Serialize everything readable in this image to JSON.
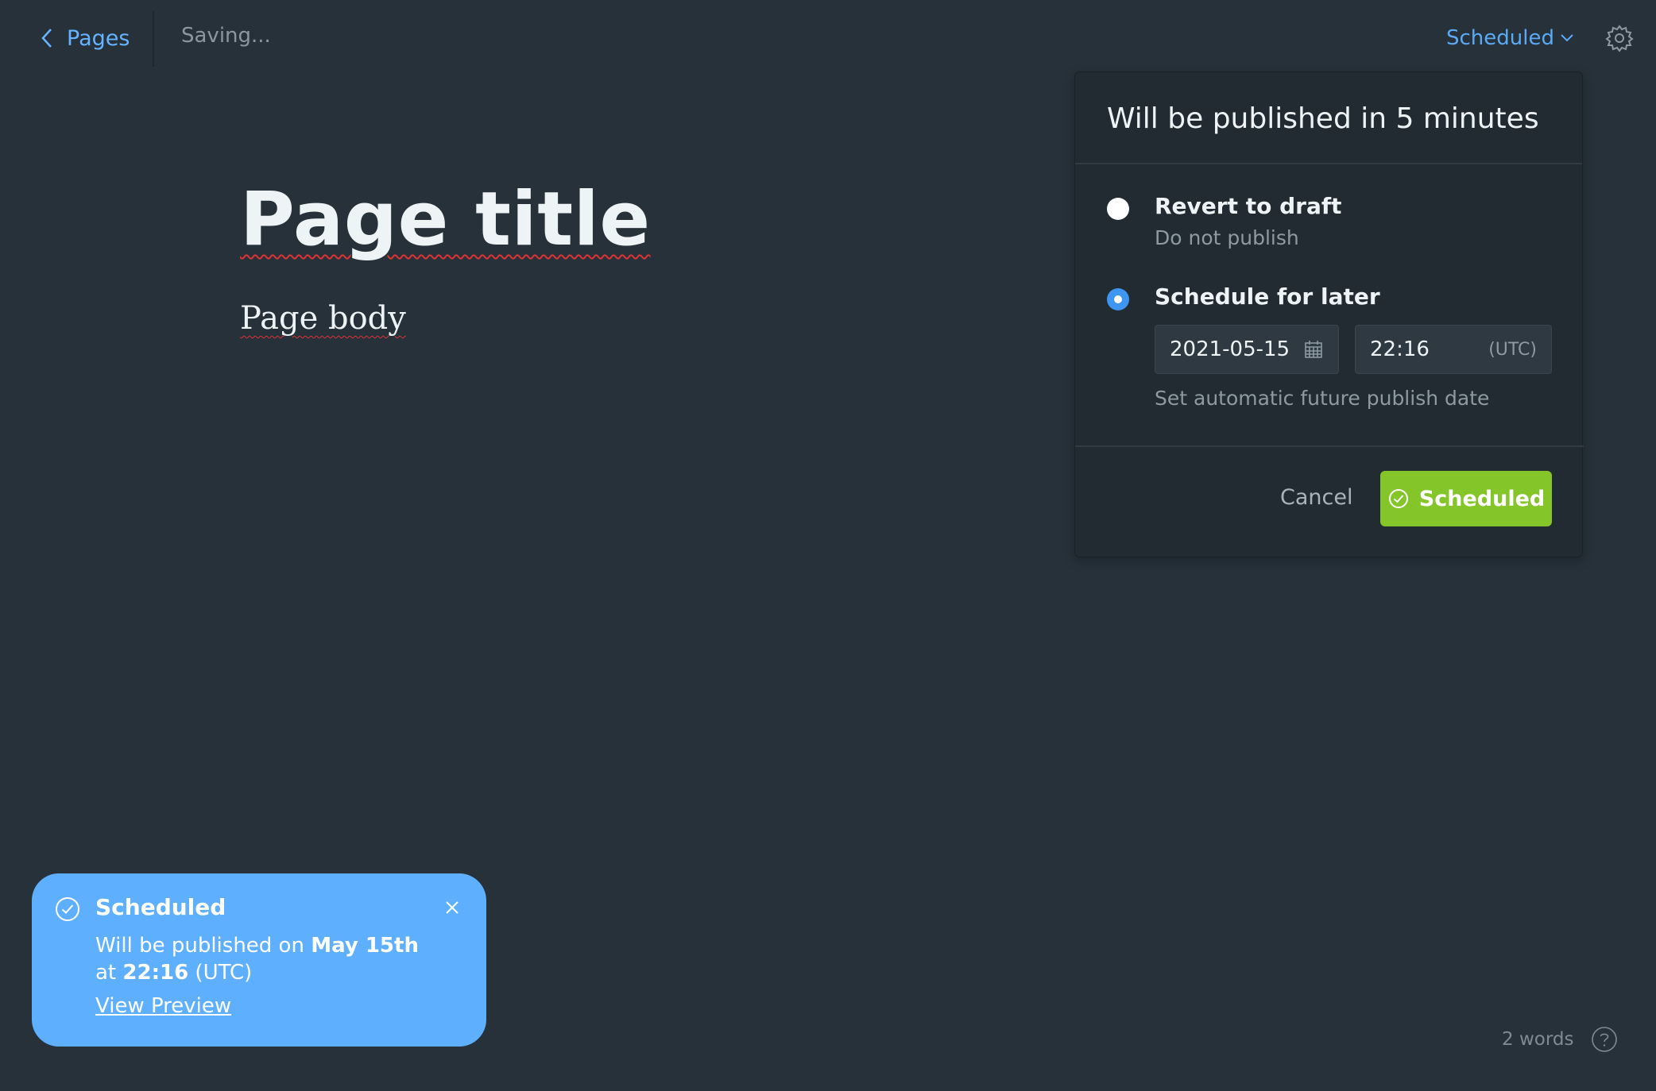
{
  "topbar": {
    "back_label": "Pages",
    "saving_text": "Saving...",
    "status_label": "Scheduled"
  },
  "editor": {
    "title": "Page title",
    "body": "Page body"
  },
  "publish_menu": {
    "heading": "Will be published in 5 minutes",
    "options": [
      {
        "label": "Revert to draft",
        "sub": "Do not publish",
        "selected": false
      },
      {
        "label": "Schedule for later",
        "selected": true
      }
    ],
    "date_value": "2021-05-15",
    "time_value": "22:16",
    "timezone": "(UTC)",
    "hint": "Set automatic future publish date",
    "cancel_label": "Cancel",
    "confirm_label": "Scheduled"
  },
  "toast": {
    "title": "Scheduled",
    "line1_prefix": "Will be published on ",
    "line1_date": "May 15th",
    "line2_prefix": "at ",
    "line2_time": "22:16",
    "line2_suffix": " (UTC)",
    "link_label": "View Preview"
  },
  "footer": {
    "word_count": "2 words"
  },
  "colors": {
    "background": "#26313a",
    "accent_blue": "#5aaaf5",
    "confirm_green": "#84c52a",
    "toast_blue": "#5eb0ff"
  },
  "icons": [
    "chevron-left-icon",
    "chevron-down-icon",
    "gear-icon",
    "calendar-icon",
    "check-circle-icon",
    "close-icon",
    "help-icon"
  ]
}
